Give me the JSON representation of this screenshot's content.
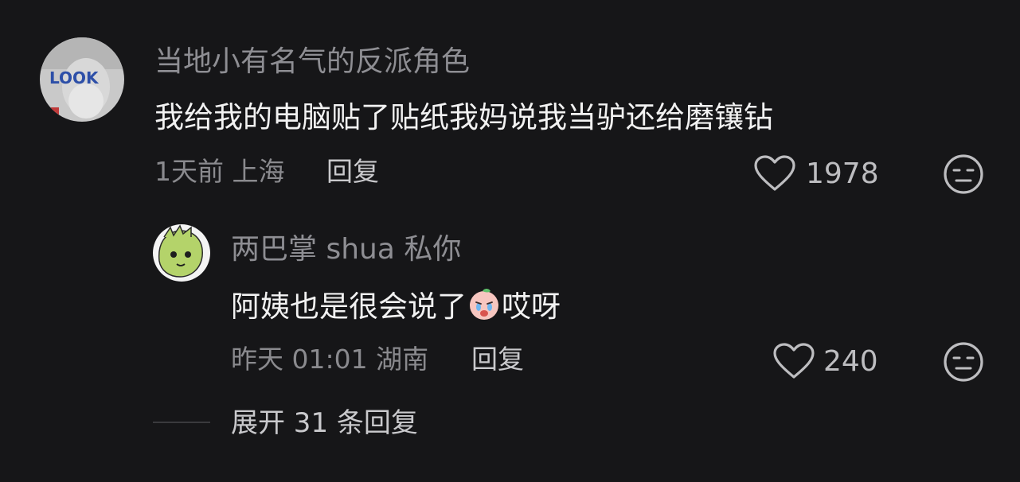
{
  "comment": {
    "username": "当地小有名气的反派角色",
    "avatar_text": "LOOK",
    "text": "我给我的电脑贴了贴纸我妈说我当驴还给磨镶钻",
    "meta": "1天前 上海",
    "reply_label": "回复",
    "like_count": "1978"
  },
  "reply": {
    "username": "两巴掌 shua 私你",
    "text_before": "阿姨也是很会说了",
    "emoji": "crying-face-emoji",
    "text_after": "哎呀",
    "meta": "昨天 01:01 湖南",
    "reply_label": "回复",
    "like_count": "240"
  },
  "expand_label": "展开 31 条回复",
  "colors": {
    "background": "#161618",
    "username": "#8e8e93",
    "content": "#f2f2f2",
    "meta": "#8a8a8e"
  }
}
